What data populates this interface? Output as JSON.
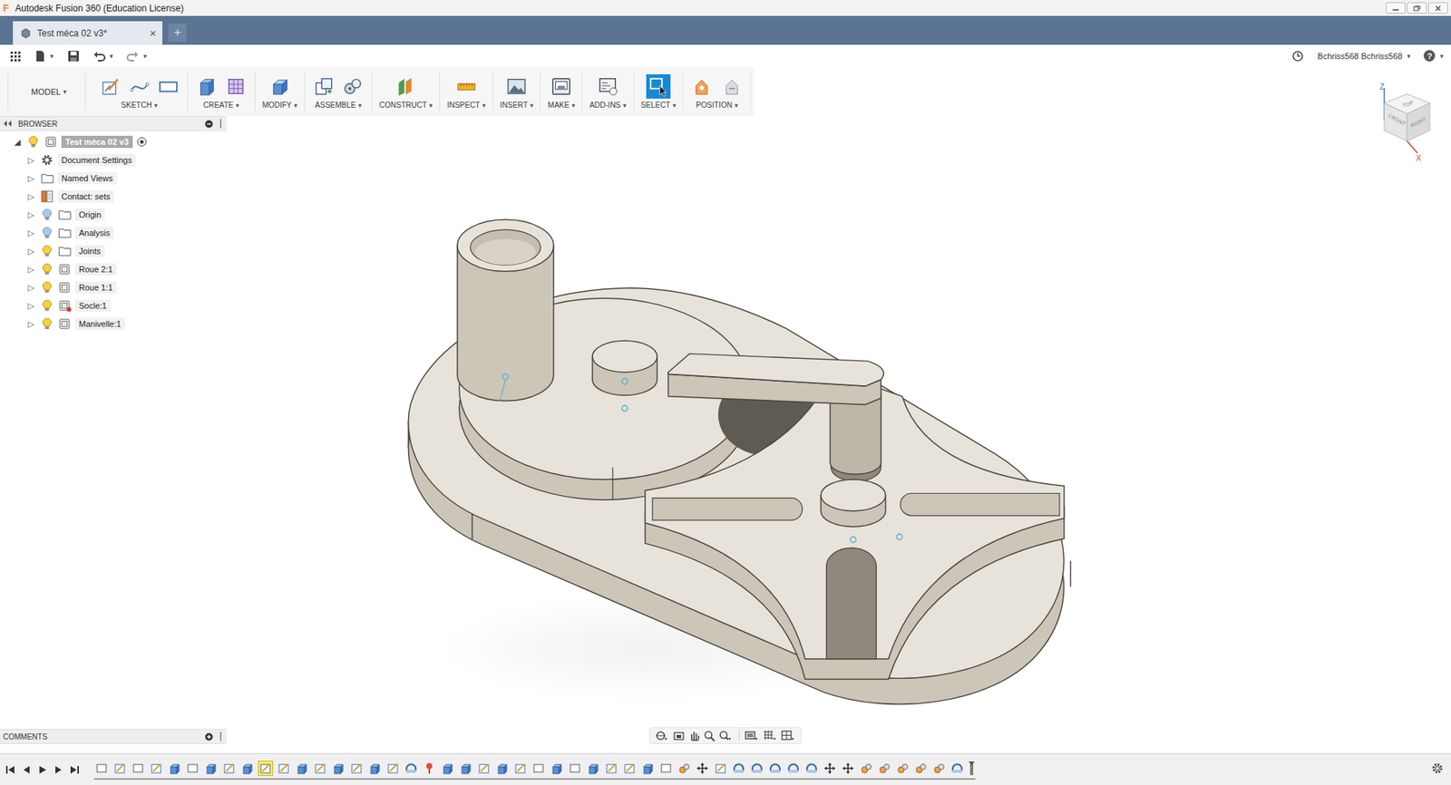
{
  "window": {
    "title": "Autodesk Fusion 360 (Education License)",
    "app_letter": "F"
  },
  "document_tab": {
    "label": "Test méca 02 v3*",
    "close": "×",
    "add": "+",
    "selected": true
  },
  "quick_access": {
    "user": "Bchriss568 Bchriss568",
    "help": "?"
  },
  "caret": "▾",
  "workspace": {
    "label": "MODEL"
  },
  "toolbar": [
    {
      "label": "SKETCH",
      "kind": "sketch",
      "selected": false
    },
    {
      "label": "CREATE",
      "kind": "create",
      "selected": false
    },
    {
      "label": "MODIFY",
      "kind": "modify",
      "selected": false
    },
    {
      "label": "ASSEMBLE",
      "kind": "assemble",
      "selected": false
    },
    {
      "label": "CONSTRUCT",
      "kind": "construct",
      "selected": false
    },
    {
      "label": "INSPECT",
      "kind": "inspect",
      "selected": false
    },
    {
      "label": "INSERT",
      "kind": "insert",
      "selected": false
    },
    {
      "label": "MAKE",
      "kind": "make",
      "selected": false
    },
    {
      "label": "ADD-INS",
      "kind": "addins",
      "selected": false
    },
    {
      "label": "SELECT",
      "kind": "select",
      "selected": true
    },
    {
      "label": "POSITION",
      "kind": "position",
      "selected": false
    }
  ],
  "expander": {
    "collapsed": "▷",
    "expanded": "◢"
  },
  "browser": {
    "title": "BROWSER",
    "root": {
      "label": "Test méca 02 v3",
      "expanded": true,
      "selected": true,
      "bulb": "on"
    },
    "items": [
      {
        "label": "Document Settings",
        "kind": "settings",
        "bulb": "none",
        "grounded": false,
        "expanded": false
      },
      {
        "label": "Named Views",
        "kind": "folder",
        "bulb": "none",
        "grounded": false,
        "expanded": false
      },
      {
        "label": "Contact: sets",
        "kind": "contacts",
        "bulb": "none",
        "grounded": false,
        "expanded": false
      },
      {
        "label": "Origin",
        "kind": "folder",
        "bulb": "off",
        "grounded": false,
        "expanded": false
      },
      {
        "label": "Analysis",
        "kind": "folder",
        "bulb": "off",
        "grounded": false,
        "expanded": false
      },
      {
        "label": "Joints",
        "kind": "folder",
        "bulb": "on",
        "grounded": false,
        "expanded": false
      },
      {
        "label": "Roue 2:1",
        "kind": "component",
        "bulb": "on",
        "grounded": false,
        "expanded": false
      },
      {
        "label": "Roue 1:1",
        "kind": "component",
        "bulb": "on",
        "grounded": false,
        "expanded": false
      },
      {
        "label": "Socle:1",
        "kind": "component",
        "bulb": "on",
        "grounded": true,
        "expanded": false
      },
      {
        "label": "Manivelle:1",
        "kind": "component",
        "bulb": "on",
        "grounded": false,
        "expanded": false
      }
    ]
  },
  "comments": {
    "title": "COMMENTS"
  },
  "viewcube": {
    "faces": [
      "TOP",
      "FRONT",
      "RIGHT"
    ],
    "axes": [
      "Z",
      "X"
    ]
  },
  "timeline": {
    "steps": [
      {
        "kind": "body",
        "selected": false
      },
      {
        "kind": "sketch",
        "selected": false
      },
      {
        "kind": "body",
        "selected": false
      },
      {
        "kind": "sketch",
        "selected": false
      },
      {
        "kind": "extrude",
        "selected": false
      },
      {
        "kind": "body",
        "selected": false
      },
      {
        "kind": "extrude",
        "selected": false
      },
      {
        "kind": "sketch",
        "selected": false
      },
      {
        "kind": "extrude",
        "selected": false
      },
      {
        "kind": "sketch",
        "selected": true
      },
      {
        "kind": "sketch",
        "selected": false
      },
      {
        "kind": "extrude",
        "selected": false
      },
      {
        "kind": "sketch",
        "selected": false
      },
      {
        "kind": "extrude",
        "selected": false
      },
      {
        "kind": "sketch",
        "selected": false
      },
      {
        "kind": "extrude",
        "selected": false
      },
      {
        "kind": "sketch",
        "selected": false
      },
      {
        "kind": "revolve",
        "selected": false
      },
      {
        "kind": "pin",
        "selected": false
      },
      {
        "kind": "extrude",
        "selected": false
      },
      {
        "kind": "extrude",
        "selected": false
      },
      {
        "kind": "sketch",
        "selected": false
      },
      {
        "kind": "extrude",
        "selected": false
      },
      {
        "kind": "sketch",
        "selected": false
      },
      {
        "kind": "body",
        "selected": false
      },
      {
        "kind": "extrude",
        "selected": false
      },
      {
        "kind": "body",
        "selected": false
      },
      {
        "kind": "extrude",
        "selected": false
      },
      {
        "kind": "sketch",
        "selected": false
      },
      {
        "kind": "sketch",
        "selected": false
      },
      {
        "kind": "extrude",
        "selected": false
      },
      {
        "kind": "body",
        "selected": false
      },
      {
        "kind": "joint",
        "selected": false
      },
      {
        "kind": "move",
        "selected": false
      },
      {
        "kind": "sketch",
        "selected": false
      },
      {
        "kind": "revolve",
        "selected": false
      },
      {
        "kind": "revolve",
        "selected": false
      },
      {
        "kind": "revolve",
        "selected": false
      },
      {
        "kind": "revolve",
        "selected": false
      },
      {
        "kind": "revolve",
        "selected": false
      },
      {
        "kind": "move",
        "selected": false
      },
      {
        "kind": "move",
        "selected": false
      },
      {
        "kind": "joint",
        "selected": false
      },
      {
        "kind": "joint",
        "selected": false
      },
      {
        "kind": "joint",
        "selected": false
      },
      {
        "kind": "joint",
        "selected": false
      },
      {
        "kind": "joint",
        "selected": false
      },
      {
        "kind": "revolve",
        "selected": false
      }
    ]
  }
}
